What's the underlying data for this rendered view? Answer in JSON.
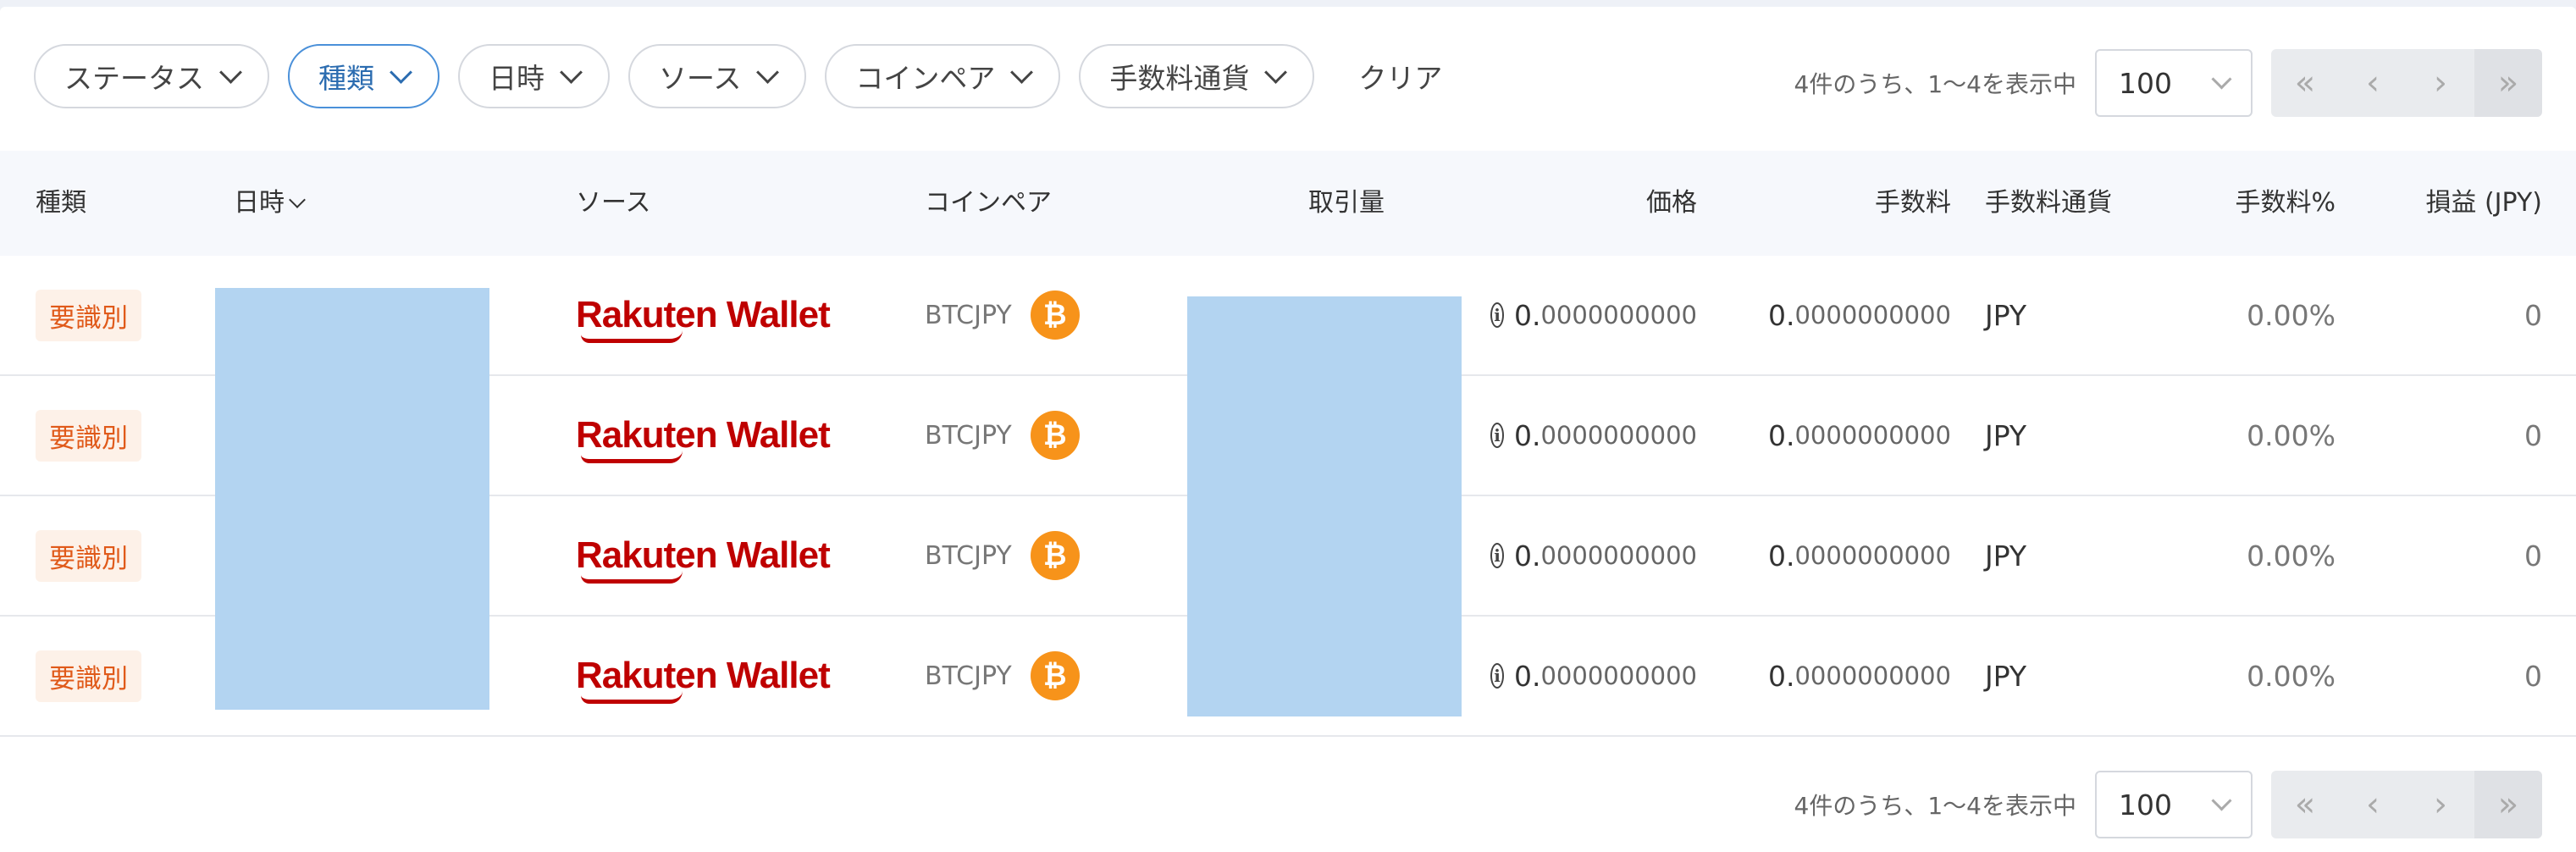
{
  "filters": {
    "chips": [
      {
        "label": "ステータス",
        "active": false
      },
      {
        "label": "種類",
        "active": true
      },
      {
        "label": "日時",
        "active": false
      },
      {
        "label": "ソース",
        "active": false
      },
      {
        "label": "コインペア",
        "active": false
      },
      {
        "label": "手数料通貨",
        "active": false
      }
    ],
    "clear_label": "クリア"
  },
  "pagination": {
    "summary": "4件のうち、1〜4を表示中",
    "per_page": "100",
    "first_icon": "double-chevron-left-icon",
    "prev_icon": "chevron-left-icon",
    "next_icon": "chevron-right-icon",
    "last_icon": "double-chevron-right-icon"
  },
  "table": {
    "columns": {
      "type": "種類",
      "datetime": "日時",
      "source": "ソース",
      "pair": "コインペア",
      "amount": "取引量",
      "price": "価格",
      "fee": "手数料",
      "fee_currency": "手数料通貨",
      "fee_pct": "手数料%",
      "pnl": "損益 (JPY)"
    },
    "rows": [
      {
        "type": "要識別",
        "source": "Rakuten Wallet",
        "pair": "BTCJPY",
        "price_int": "0.",
        "price_frac": "0000000000",
        "fee_int": "0.",
        "fee_frac": "0000000000",
        "fee_currency": "JPY",
        "fee_pct": "0.00%",
        "pnl": "0"
      },
      {
        "type": "要識別",
        "source": "Rakuten Wallet",
        "pair": "BTCJPY",
        "price_int": "0.",
        "price_frac": "0000000000",
        "fee_int": "0.",
        "fee_frac": "0000000000",
        "fee_currency": "JPY",
        "fee_pct": "0.00%",
        "pnl": "0"
      },
      {
        "type": "要識別",
        "source": "Rakuten Wallet",
        "pair": "BTCJPY",
        "price_int": "0.",
        "price_frac": "0000000000",
        "fee_int": "0.",
        "fee_frac": "0000000000",
        "fee_currency": "JPY",
        "fee_pct": "0.00%",
        "pnl": "0"
      },
      {
        "type": "要識別",
        "source": "Rakuten Wallet",
        "pair": "BTCJPY",
        "price_int": "0.",
        "price_frac": "0000000000",
        "fee_int": "0.",
        "fee_frac": "0000000000",
        "fee_currency": "JPY",
        "fee_pct": "0.00%",
        "pnl": "0"
      }
    ]
  },
  "icons": {
    "coin": "bitcoin-icon",
    "info": "info-icon",
    "btc_symbol": "₿"
  },
  "colors": {
    "accent": "#4a90d9",
    "badge_text": "#e05a1a",
    "badge_bg": "#fdf1e8",
    "rakuten_red": "#bf0000",
    "bitcoin_orange": "#f7931a",
    "redaction": "#b3d4f1"
  }
}
